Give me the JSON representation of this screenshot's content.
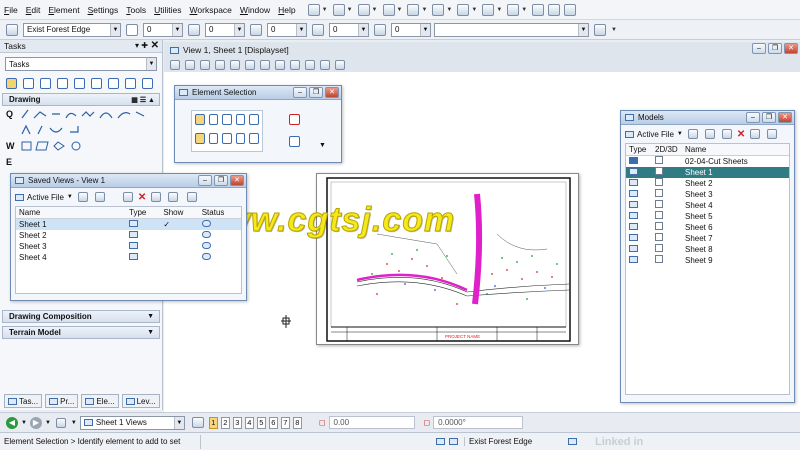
{
  "menubar": {
    "items": [
      "File",
      "Edit",
      "Element",
      "Settings",
      "Tools",
      "Utilities",
      "Workspace",
      "Window",
      "Help"
    ]
  },
  "toolbar2": {
    "level_combo": "Exist Forest Edge",
    "color_value": "0",
    "style_value": "0",
    "weight_value": "0",
    "transparency_value": "0",
    "priority_value": "0"
  },
  "tasks": {
    "title": "Tasks",
    "combo": "Tasks",
    "drawing_section": "Drawing",
    "drawing_composition": "Drawing Composition",
    "terrain_model": "Terrain Model",
    "row_letters": [
      "Q",
      "W",
      "E"
    ],
    "bottom_tabs": [
      "Tas...",
      "Pr...",
      "Ele...",
      "Lev..."
    ]
  },
  "view": {
    "title": "View 1, Sheet 1 [Displayset]"
  },
  "element_selection": {
    "title": "Element Selection"
  },
  "saved_views": {
    "title": "Saved Views - View 1",
    "scope": "Active File",
    "columns": [
      "Name",
      "Type",
      "Show",
      "Status"
    ],
    "rows": [
      {
        "name": "Sheet 1",
        "show": "✓"
      },
      {
        "name": "Sheet 2",
        "show": ""
      },
      {
        "name": "Sheet 3",
        "show": ""
      },
      {
        "name": "Sheet 4",
        "show": ""
      }
    ]
  },
  "models": {
    "title": "Models",
    "scope": "Active File",
    "columns": [
      "Type",
      "2D/3D",
      "Name"
    ],
    "rows": [
      "02-04-Cut Sheets",
      "Sheet 1",
      "Sheet 2",
      "Sheet 3",
      "Sheet 4",
      "Sheet 5",
      "Sheet 6",
      "Sheet 7",
      "Sheet 8",
      "Sheet 9"
    ],
    "selected_index": 1
  },
  "drawing": {
    "title_block_label": "PROJECT NAME"
  },
  "watermark": "www.cgtsj.com",
  "bottombar": {
    "views_combo": "Sheet 1 Views",
    "view_numbers": [
      "1",
      "2",
      "3",
      "4",
      "5",
      "6",
      "7",
      "8"
    ],
    "active_view": "1",
    "coord_field": "0.00",
    "angle_field": "0.0000°"
  },
  "statusbar": {
    "prompt": "Element Selection > Identify element to add to set",
    "level": "Exist Forest Edge",
    "brand": "Linked in"
  },
  "colors": {
    "accent": "#2f7c84",
    "watermark": "#f5e81b",
    "drawing_magenta": "#e020c8"
  }
}
